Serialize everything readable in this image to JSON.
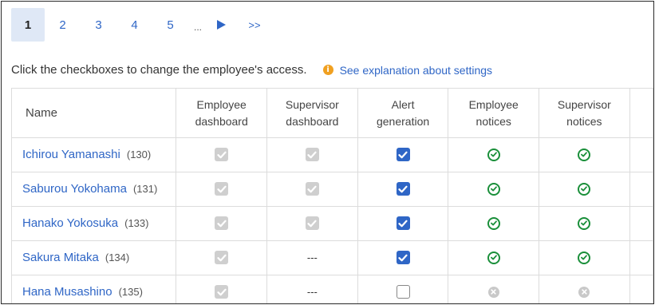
{
  "pagination": {
    "active": "1",
    "pages": [
      "2",
      "3",
      "4",
      "5"
    ],
    "ellipsis": "...",
    "last_label": ">>"
  },
  "intro_text": "Click the checkboxes to change the employee's access.",
  "explanation_link": "See explanation about settings",
  "colors": {
    "accent": "#2f66c6",
    "ok": "#1a8f3a",
    "disabled": "#cfcfcf"
  },
  "table": {
    "headers": {
      "name": "Name",
      "emp_dash": [
        "Employee",
        "dashboard"
      ],
      "sup_dash": [
        "Supervisor",
        "dashboard"
      ],
      "alert": [
        "Alert",
        "generation"
      ],
      "emp_notice": [
        "Employee",
        "notices"
      ],
      "sup_notice": [
        "Supervisor",
        "notices"
      ]
    },
    "rows": [
      {
        "name": "Ichirou Yamanashi",
        "id": "(130)",
        "emp_dash": "checked-disabled",
        "sup_dash": "checked-disabled",
        "alert": "checked",
        "emp_notice": "check-circle",
        "sup_notice": "check-circle"
      },
      {
        "name": "Saburou Yokohama",
        "id": "(131)",
        "emp_dash": "checked-disabled",
        "sup_dash": "checked-disabled",
        "alert": "checked",
        "emp_notice": "check-circle",
        "sup_notice": "check-circle"
      },
      {
        "name": "Hanako Yokosuka",
        "id": "(133)",
        "emp_dash": "checked-disabled",
        "sup_dash": "checked-disabled",
        "alert": "checked",
        "emp_notice": "check-circle",
        "sup_notice": "check-circle"
      },
      {
        "name": "Sakura Mitaka",
        "id": "(134)",
        "emp_dash": "checked-disabled",
        "sup_dash": "---",
        "alert": "checked",
        "emp_notice": "check-circle",
        "sup_notice": "check-circle"
      },
      {
        "name": "Hana Musashino",
        "id": "(135)",
        "emp_dash": "checked-disabled",
        "sup_dash": "---",
        "alert": "unchecked",
        "emp_notice": "x-circle",
        "sup_notice": "x-circle"
      }
    ]
  }
}
